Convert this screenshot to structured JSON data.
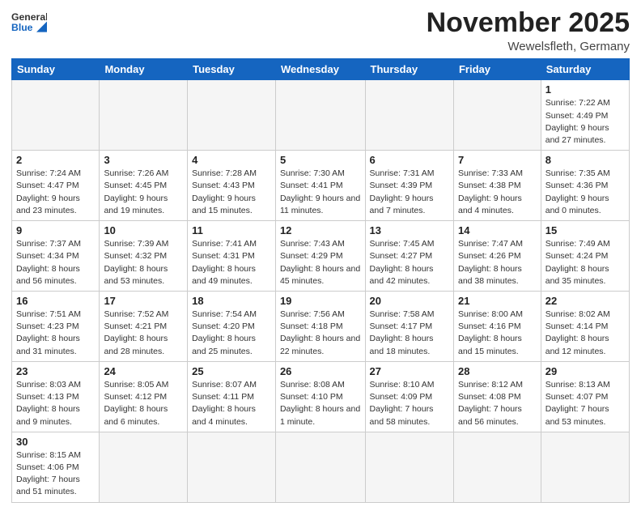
{
  "header": {
    "logo_general": "General",
    "logo_blue": "Blue",
    "title": "November 2025",
    "subtitle": "Wewelsfleth, Germany"
  },
  "days_of_week": [
    "Sunday",
    "Monday",
    "Tuesday",
    "Wednesday",
    "Thursday",
    "Friday",
    "Saturday"
  ],
  "weeks": [
    [
      {
        "day": "",
        "info": ""
      },
      {
        "day": "",
        "info": ""
      },
      {
        "day": "",
        "info": ""
      },
      {
        "day": "",
        "info": ""
      },
      {
        "day": "",
        "info": ""
      },
      {
        "day": "",
        "info": ""
      },
      {
        "day": "1",
        "info": "Sunrise: 7:22 AM\nSunset: 4:49 PM\nDaylight: 9 hours\nand 27 minutes."
      }
    ],
    [
      {
        "day": "2",
        "info": "Sunrise: 7:24 AM\nSunset: 4:47 PM\nDaylight: 9 hours\nand 23 minutes."
      },
      {
        "day": "3",
        "info": "Sunrise: 7:26 AM\nSunset: 4:45 PM\nDaylight: 9 hours\nand 19 minutes."
      },
      {
        "day": "4",
        "info": "Sunrise: 7:28 AM\nSunset: 4:43 PM\nDaylight: 9 hours\nand 15 minutes."
      },
      {
        "day": "5",
        "info": "Sunrise: 7:30 AM\nSunset: 4:41 PM\nDaylight: 9 hours\nand 11 minutes."
      },
      {
        "day": "6",
        "info": "Sunrise: 7:31 AM\nSunset: 4:39 PM\nDaylight: 9 hours\nand 7 minutes."
      },
      {
        "day": "7",
        "info": "Sunrise: 7:33 AM\nSunset: 4:38 PM\nDaylight: 9 hours\nand 4 minutes."
      },
      {
        "day": "8",
        "info": "Sunrise: 7:35 AM\nSunset: 4:36 PM\nDaylight: 9 hours\nand 0 minutes."
      }
    ],
    [
      {
        "day": "9",
        "info": "Sunrise: 7:37 AM\nSunset: 4:34 PM\nDaylight: 8 hours\nand 56 minutes."
      },
      {
        "day": "10",
        "info": "Sunrise: 7:39 AM\nSunset: 4:32 PM\nDaylight: 8 hours\nand 53 minutes."
      },
      {
        "day": "11",
        "info": "Sunrise: 7:41 AM\nSunset: 4:31 PM\nDaylight: 8 hours\nand 49 minutes."
      },
      {
        "day": "12",
        "info": "Sunrise: 7:43 AM\nSunset: 4:29 PM\nDaylight: 8 hours\nand 45 minutes."
      },
      {
        "day": "13",
        "info": "Sunrise: 7:45 AM\nSunset: 4:27 PM\nDaylight: 8 hours\nand 42 minutes."
      },
      {
        "day": "14",
        "info": "Sunrise: 7:47 AM\nSunset: 4:26 PM\nDaylight: 8 hours\nand 38 minutes."
      },
      {
        "day": "15",
        "info": "Sunrise: 7:49 AM\nSunset: 4:24 PM\nDaylight: 8 hours\nand 35 minutes."
      }
    ],
    [
      {
        "day": "16",
        "info": "Sunrise: 7:51 AM\nSunset: 4:23 PM\nDaylight: 8 hours\nand 31 minutes."
      },
      {
        "day": "17",
        "info": "Sunrise: 7:52 AM\nSunset: 4:21 PM\nDaylight: 8 hours\nand 28 minutes."
      },
      {
        "day": "18",
        "info": "Sunrise: 7:54 AM\nSunset: 4:20 PM\nDaylight: 8 hours\nand 25 minutes."
      },
      {
        "day": "19",
        "info": "Sunrise: 7:56 AM\nSunset: 4:18 PM\nDaylight: 8 hours\nand 22 minutes."
      },
      {
        "day": "20",
        "info": "Sunrise: 7:58 AM\nSunset: 4:17 PM\nDaylight: 8 hours\nand 18 minutes."
      },
      {
        "day": "21",
        "info": "Sunrise: 8:00 AM\nSunset: 4:16 PM\nDaylight: 8 hours\nand 15 minutes."
      },
      {
        "day": "22",
        "info": "Sunrise: 8:02 AM\nSunset: 4:14 PM\nDaylight: 8 hours\nand 12 minutes."
      }
    ],
    [
      {
        "day": "23",
        "info": "Sunrise: 8:03 AM\nSunset: 4:13 PM\nDaylight: 8 hours\nand 9 minutes."
      },
      {
        "day": "24",
        "info": "Sunrise: 8:05 AM\nSunset: 4:12 PM\nDaylight: 8 hours\nand 6 minutes."
      },
      {
        "day": "25",
        "info": "Sunrise: 8:07 AM\nSunset: 4:11 PM\nDaylight: 8 hours\nand 4 minutes."
      },
      {
        "day": "26",
        "info": "Sunrise: 8:08 AM\nSunset: 4:10 PM\nDaylight: 8 hours\nand 1 minute."
      },
      {
        "day": "27",
        "info": "Sunrise: 8:10 AM\nSunset: 4:09 PM\nDaylight: 7 hours\nand 58 minutes."
      },
      {
        "day": "28",
        "info": "Sunrise: 8:12 AM\nSunset: 4:08 PM\nDaylight: 7 hours\nand 56 minutes."
      },
      {
        "day": "29",
        "info": "Sunrise: 8:13 AM\nSunset: 4:07 PM\nDaylight: 7 hours\nand 53 minutes."
      }
    ],
    [
      {
        "day": "30",
        "info": "Sunrise: 8:15 AM\nSunset: 4:06 PM\nDaylight: 7 hours\nand 51 minutes."
      },
      {
        "day": "",
        "info": ""
      },
      {
        "day": "",
        "info": ""
      },
      {
        "day": "",
        "info": ""
      },
      {
        "day": "",
        "info": ""
      },
      {
        "day": "",
        "info": ""
      },
      {
        "day": "",
        "info": ""
      }
    ]
  ]
}
